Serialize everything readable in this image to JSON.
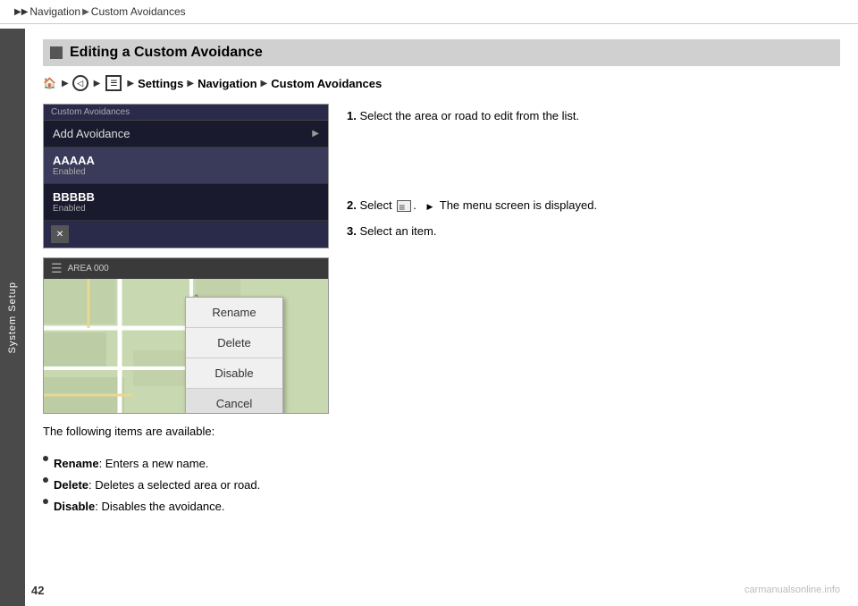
{
  "topbar": {
    "arrows": "▶▶",
    "crumb1": "Navigation",
    "crumb2": "Custom Avoidances",
    "arrow_char": "▶"
  },
  "sidebar": {
    "label": "System Setup"
  },
  "page_number": "42",
  "section_heading": "Editing a Custom Avoidance",
  "path_line": {
    "settings": "Settings",
    "navigation": "Navigation",
    "custom": "Custom Avoidances"
  },
  "screen1": {
    "title": "Custom Avoidances",
    "add_item": "Add Avoidance",
    "item1_name": "AAAAA",
    "item1_status": "Enabled",
    "item2_name": "BBBBB",
    "item2_status": "Enabled"
  },
  "screen2": {
    "area_label": "AREA 000",
    "popup": {
      "rename": "Rename",
      "delete": "Delete",
      "disable": "Disable",
      "cancel": "Cancel"
    }
  },
  "instructions": {
    "step1": "Select the area or road to edit from the list.",
    "step2": "Select",
    "step2b": "The menu screen is displayed.",
    "step3": "Select an item."
  },
  "bullet_intro": "The following items are available:",
  "bullets": [
    {
      "label": "Rename",
      "desc": "Enters a new name."
    },
    {
      "label": "Delete",
      "desc": "Deletes a selected area or road."
    },
    {
      "label": "Disable",
      "desc": "Disables the avoidance."
    }
  ],
  "watermark": "carmanualsonline.info"
}
